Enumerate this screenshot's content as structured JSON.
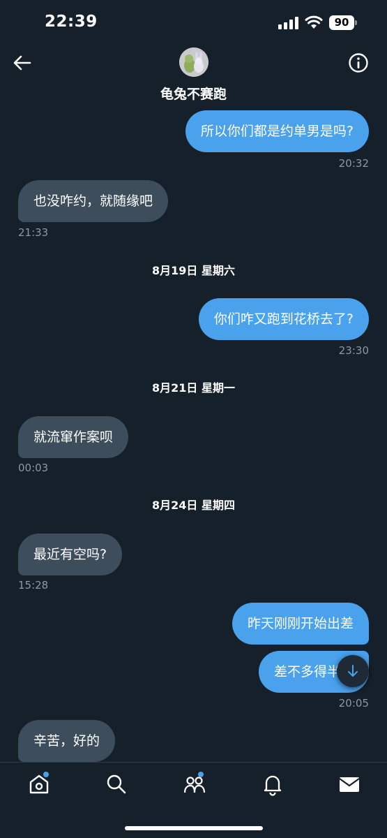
{
  "status_bar": {
    "time": "22:39",
    "battery": "90"
  },
  "header": {
    "contact_name": "龟兔不赛跑"
  },
  "messages": [
    {
      "text": "所以你们都是约单男是吗?",
      "time": "20:32"
    },
    {
      "text": "也没咋约，就随缘吧",
      "time": "21:33"
    },
    {
      "date": "8月19日 星期六"
    },
    {
      "text": "你们咋又跑到花桥去了?",
      "time": "23:30"
    },
    {
      "date": "8月21日 星期一"
    },
    {
      "text": "就流窜作案呗",
      "time": "00:03"
    },
    {
      "date": "8月24日 星期四"
    },
    {
      "text": "最近有空吗?",
      "time": "15:28"
    },
    {
      "text": "昨天刚刚开始出差"
    },
    {
      "text": "差不多得半个",
      "time": "20:05"
    },
    {
      "text": "辛苦，好的"
    }
  ],
  "colors": {
    "background": "#15202b",
    "outgoing": "#4aa1ec",
    "incoming": "#3d4d5c",
    "accent": "#4aa1ec"
  },
  "icons": {
    "back": "arrow-left-icon",
    "info": "info-icon",
    "scroll": "arrow-down-icon",
    "nav": [
      "home-icon",
      "search-icon",
      "communities-icon",
      "bell-icon",
      "mail-icon"
    ]
  }
}
